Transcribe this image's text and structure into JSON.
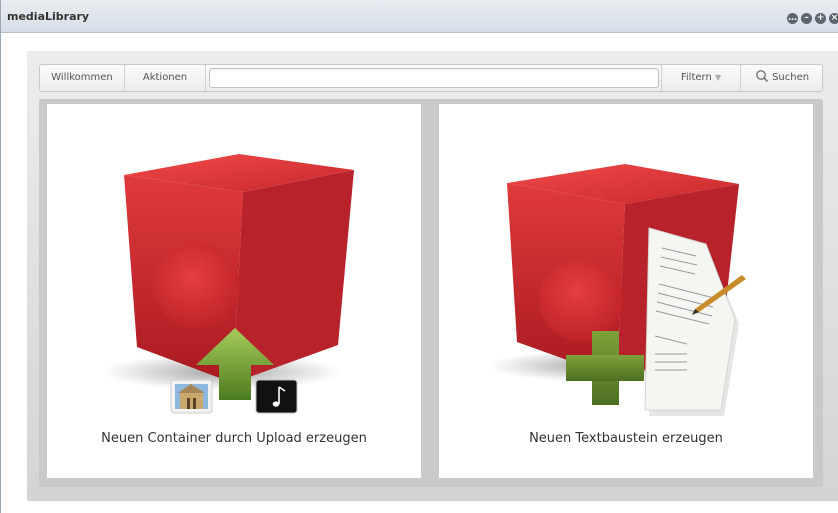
{
  "window": {
    "title": "mediaLibrary",
    "controls": [
      "more",
      "minimize",
      "maximize",
      "close"
    ]
  },
  "toolbar": {
    "welcome_label": "Willkommen",
    "actions_label": "Aktionen",
    "search_value": "",
    "filter_label": "Filtern",
    "filter_icon": "chevron-down-icon",
    "search_label": "Suchen",
    "search_icon": "search-icon"
  },
  "cards": [
    {
      "label": "Neuen Container durch Upload erzeugen",
      "icons": [
        "red-cube-icon",
        "upload-arrow-icon",
        "image-thumbnail-icon",
        "music-note-icon"
      ]
    },
    {
      "label": "Neuen Textbaustein erzeugen",
      "icons": [
        "red-cube-icon",
        "document-icon",
        "pencil-icon",
        "plus-icon"
      ]
    }
  ],
  "colors": {
    "cube_red": "#c4262b",
    "arrow_green": "#6a9a2e",
    "plus_green": "#5a7d2a"
  }
}
